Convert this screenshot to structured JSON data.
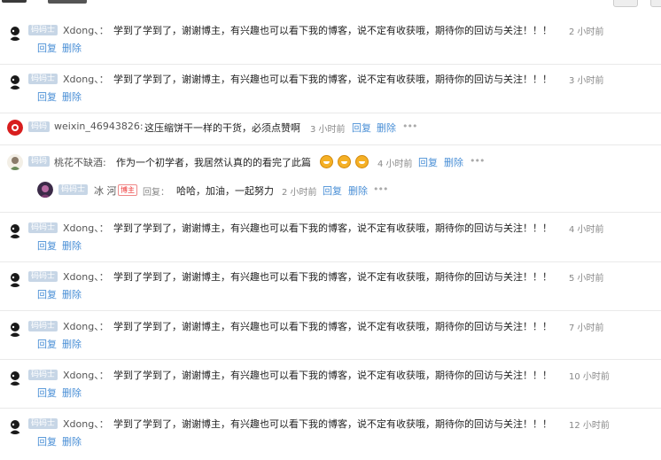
{
  "actions": {
    "reply": "回复",
    "delete": "删除",
    "more": "•••"
  },
  "comments": [
    {
      "level": "码码士",
      "user": "Xdong、：",
      "text": "学到了学到了，谢谢博主，有兴趣也可以看下我的博客，说不定有收获哦，期待你的回访与关注！！！",
      "time": "2 小时前"
    },
    {
      "level": "码码士",
      "user": "Xdong、：",
      "text": "学到了学到了，谢谢博主，有兴趣也可以看下我的博客，说不定有收获哦，期待你的回访与关注！！！",
      "time": "3 小时前"
    },
    {
      "level": "码码",
      "user": "weixin_46943826:",
      "text": "这压缩饼干一样的干货，必须点赞啊",
      "time": "3 小时前"
    },
    {
      "level": "码码",
      "user": "桃花不缺酒:",
      "text": "作为一个初学者，我居然认真的的看完了此篇",
      "time": "4 小时前",
      "reply": {
        "level": "码码士",
        "user": "冰 河",
        "host_tag": "博主",
        "reply_label": "回复：",
        "text": "哈哈，加油，一起努力",
        "time": "2 小时前"
      }
    },
    {
      "level": "码码士",
      "user": "Xdong、：",
      "text": "学到了学到了，谢谢博主，有兴趣也可以看下我的博客，说不定有收获哦，期待你的回访与关注！！！",
      "time": "4 小时前"
    },
    {
      "level": "码码士",
      "user": "Xdong、：",
      "text": "学到了学到了，谢谢博主，有兴趣也可以看下我的博客，说不定有收获哦，期待你的回访与关注！！！",
      "time": "5 小时前"
    },
    {
      "level": "码码士",
      "user": "Xdong、：",
      "text": "学到了学到了，谢谢博主，有兴趣也可以看下我的博客，说不定有收获哦，期待你的回访与关注！！！",
      "time": "7 小时前"
    },
    {
      "level": "码码士",
      "user": "Xdong、：",
      "text": "学到了学到了，谢谢博主，有兴趣也可以看下我的博客，说不定有收获哦，期待你的回访与关注！！！",
      "time": "10 小时前"
    },
    {
      "level": "码码士",
      "user": "Xdong、：",
      "text": "学到了学到了，谢谢博主，有兴趣也可以看下我的博客，说不定有收获哦，期待你的回访与关注！！！",
      "time": "12 小时前"
    }
  ],
  "icons": {
    "user_avatar": "user-avatar",
    "emoji": "grin-emoji",
    "more": "more-dots-icon"
  },
  "colors": {
    "link": "#4a8fd6",
    "level_badge": "#c7d6e6",
    "host_tag": "#e33"
  }
}
